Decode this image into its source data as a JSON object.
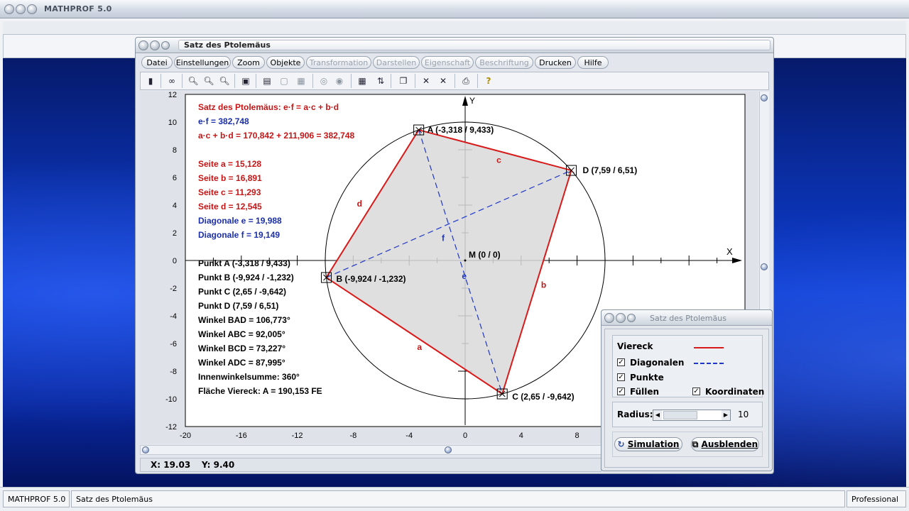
{
  "app": {
    "title": "MATHPROF 5.0"
  },
  "status": {
    "app": "MATHPROF 5.0",
    "doc": "Satz des Ptolemäus",
    "edition": "Professional"
  },
  "window": {
    "title": "Satz des Ptolemäus",
    "menu": [
      {
        "label": "Datei",
        "enabled": true
      },
      {
        "label": "Einstellungen",
        "enabled": true
      },
      {
        "label": "Zoom",
        "enabled": true
      },
      {
        "label": "Objekte",
        "enabled": true
      },
      {
        "label": "Transformation",
        "enabled": false
      },
      {
        "label": "Darstellen",
        "enabled": false
      },
      {
        "label": "Eigenschaft",
        "enabled": false
      },
      {
        "label": "Beschriftung",
        "enabled": false
      },
      {
        "label": "Drucken",
        "enabled": true
      },
      {
        "label": "Hilfe",
        "enabled": true
      }
    ],
    "coords": {
      "x": "X: 19.03",
      "y": "Y: 9.40"
    }
  },
  "plot": {
    "x_ticks": [
      "-20",
      "-16",
      "-12",
      "-8",
      "-4",
      "0",
      "4",
      "8"
    ],
    "y_ticks": [
      "12",
      "10",
      "8",
      "6",
      "4",
      "2",
      "0",
      "-2",
      "-4",
      "-6",
      "-8",
      "-10",
      "-12"
    ],
    "axis_x": "X",
    "axis_y": "Y",
    "center_label": "M (0 / 0)",
    "points": {
      "A": {
        "x": -3.318,
        "y": 9.433,
        "label": "A (-3,318 / 9,433)"
      },
      "B": {
        "x": -9.924,
        "y": -1.232,
        "label": "B (-9,924 / -1,232)"
      },
      "C": {
        "x": 2.65,
        "y": -9.642,
        "label": "C (2,65 / -9,642)"
      },
      "D": {
        "x": 7.59,
        "y": 6.51,
        "label": "D (7,59 / 6,51)"
      }
    },
    "radius": 10,
    "side_labels": {
      "a": "a",
      "b": "b",
      "c": "c",
      "d": "d",
      "e": "e",
      "f": "f"
    },
    "info_red": [
      "Satz des Ptolemäus: e·f = a·c + b·d"
    ],
    "info_ef": "e·f = 382,748",
    "info_sum": "a·c + b·d = 170,842 + 211,906 = 382,748",
    "sides": [
      "Seite a = 15,128",
      "Seite b = 16,891",
      "Seite c = 11,293",
      "Seite d = 12,545"
    ],
    "diagonals": [
      "Diagonale e = 19,988",
      "Diagonale f = 19,149"
    ],
    "facts": [
      "Punkt A (-3,318 / 9,433)",
      "Punkt B (-9,924 / -1,232)",
      "Punkt C (2,65 / -9,642)",
      "Punkt D (7,59 / 6,51)",
      "Winkel BAD = 106,773°",
      "Winkel ABC = 92,005°",
      "Winkel BCD = 73,227°",
      "Winkel ADC = 87,995°",
      "Innenwinkelsumme: 360°",
      "Fläche Viereck: A = 190,153 FE"
    ],
    "colors": {
      "quad": "#d81a1a",
      "diag": "#1f37c8",
      "fill": "#d9d9d9",
      "text_red": "#c41616",
      "text_blue": "#1b2fa8"
    }
  },
  "panel": {
    "title": "Satz des Ptolemäus",
    "viereck": "Viereck",
    "diagonalen": "Diagonalen",
    "punkte": "Punkte",
    "fuellen": "Füllen",
    "koordinaten": "Koordinaten",
    "radius_label": "Radius:",
    "radius_value": "10",
    "simulation": "Simulation",
    "ausblenden": "Ausblenden"
  }
}
